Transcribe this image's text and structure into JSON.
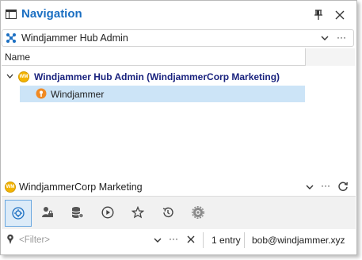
{
  "window": {
    "title": "Navigation"
  },
  "hub_selector": {
    "value": "Windjammer Hub Admin",
    "more": "···"
  },
  "tree": {
    "column_header": "Name",
    "root": {
      "badge": "WM",
      "label": "Windjammer Hub Admin (WindjammerCorp Marketing)"
    },
    "child": {
      "label": "Windjammer"
    }
  },
  "org_selector": {
    "badge": "WM",
    "value": "WindjammerCorp Marketing",
    "more": "···"
  },
  "toolbar": {
    "items": [
      {
        "name": "settings-circle-icon",
        "active": true
      },
      {
        "name": "user-lock-icon",
        "active": false
      },
      {
        "name": "database-settings-icon",
        "active": false
      },
      {
        "name": "play-circle-icon",
        "active": false
      },
      {
        "name": "star-icon",
        "active": false
      },
      {
        "name": "history-icon",
        "active": false
      },
      {
        "name": "gear-globe-icon",
        "active": false
      }
    ]
  },
  "status": {
    "filter_placeholder": "<Filter>",
    "more": "···",
    "entry_count": "1 entry",
    "user": "bob@windjammer.xyz"
  },
  "colors": {
    "accent": "#1b6fc2",
    "selection": "#cce4f7",
    "root_label": "#1a237e",
    "badge": "#f4b400",
    "pin_orange": "#f08a24"
  }
}
